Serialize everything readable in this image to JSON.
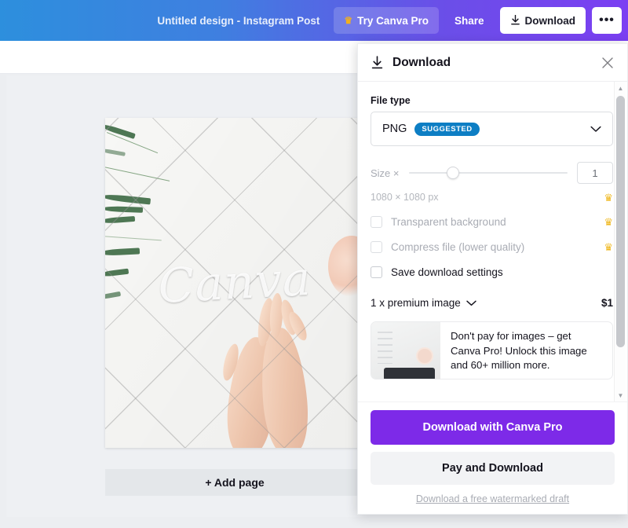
{
  "topbar": {
    "doc_title": "Untitled design - Instagram Post",
    "try_pro_label": "Try Canva Pro",
    "share_label": "Share",
    "download_label": "Download",
    "more_label": "•••",
    "crown_glyph": "♛",
    "gradient_start": "#2d8fdd",
    "gradient_end": "#7b3ff2"
  },
  "canvas": {
    "watermark_text": "Canva",
    "add_page_label": "+ Add page"
  },
  "panel": {
    "title": "Download",
    "close_label": "✕",
    "file_type": {
      "label": "File type",
      "value": "PNG",
      "badge": "SUGGESTED",
      "badge_color": "#0d7ec4"
    },
    "size": {
      "label": "Size ×",
      "value": "1",
      "dimensions": "1080 × 1080 px",
      "slider_percent": 28,
      "crown_glyph": "♛"
    },
    "options": [
      {
        "label": "Transparent background",
        "checked": false,
        "premium": true,
        "disabled": true
      },
      {
        "label": "Compress file (lower quality)",
        "checked": false,
        "premium": true,
        "disabled": true
      },
      {
        "label": "Save download settings",
        "checked": false,
        "premium": false,
        "disabled": false
      }
    ],
    "premium": {
      "label": "1 x premium image",
      "price": "$1"
    },
    "promo": {
      "text": "Don't pay for images – get Canva Pro! Unlock this image and 60+ million more."
    },
    "footer": {
      "primary_label": "Download with Canva Pro",
      "secondary_label": "Pay and Download",
      "free_link_label": "Download a free watermarked draft",
      "primary_color": "#7d2ae8"
    }
  }
}
